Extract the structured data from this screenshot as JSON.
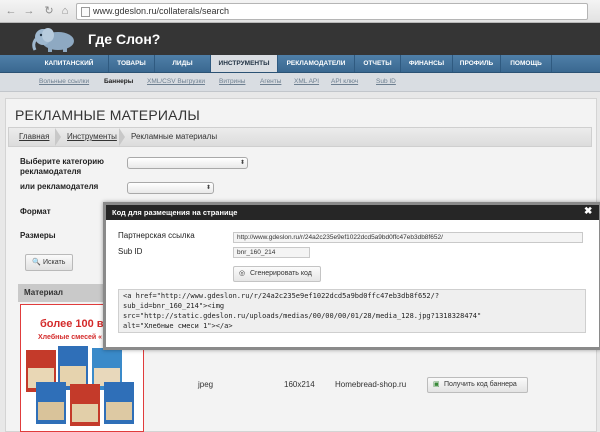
{
  "browser": {
    "url": "www.gdeslon.ru/collaterals/search"
  },
  "site": {
    "logo_text": "Где Слон?"
  },
  "nav": {
    "items": [
      {
        "label": "КАПИТАНСКИЙ МОСТИК"
      },
      {
        "label": "ТОВАРЫ"
      },
      {
        "label": "ЛИДЫ"
      },
      {
        "label": "ИНСТРУМЕНТЫ",
        "active": true
      },
      {
        "label": "РЕКЛАМОДАТЕЛИ"
      },
      {
        "label": "ОТЧЕТЫ"
      },
      {
        "label": "ФИНАНСЫ"
      },
      {
        "label": "ПРОФИЛЬ"
      },
      {
        "label": "ПОМОЩЬ"
      }
    ]
  },
  "subnav": {
    "items": [
      {
        "label": "Вольные ссылки"
      },
      {
        "label": "Баннеры",
        "active": true
      },
      {
        "label": "XML/CSV Выгрузки"
      },
      {
        "label": "Витрины"
      },
      {
        "label": "Агенты"
      },
      {
        "label": "XML API"
      },
      {
        "label": "API ключ"
      },
      {
        "label": "Sub ID"
      }
    ]
  },
  "page": {
    "title": "РЕКЛАМНЫЕ МАТЕРИАЛЫ",
    "breadcrumb": [
      "Главная",
      "Инструменты",
      "Рекламные материалы"
    ]
  },
  "filters": {
    "category_label_line1": "Выберите категорию",
    "category_label_line2": "рекламодателя",
    "advertiser_label": "или рекламодателя",
    "format_label": "Формат",
    "sizes_label": "Размеры",
    "search_button": "Искать"
  },
  "results": {
    "material_header": "Материал",
    "banner_headline": "более 100 в",
    "banner_sub": "Хлебные смесей «",
    "row": {
      "format": "jpeg",
      "size": "160x214",
      "advertiser": "Homebread-shop.ru",
      "button": "Получить код баннера"
    }
  },
  "modal": {
    "title": "Код для размещения на странице",
    "partner_link_label": "Партнерская ссылка",
    "partner_link_value": "http://www.gdeslon.ru/r/24a2c235e9ef1022dcd5a9bd0ffc47eb3db8f652/",
    "subid_label": "Sub ID",
    "subid_value": "bnr_160_214",
    "generate_button": "Сгенерировать код",
    "code_lines": [
      "<a href=\"http://www.gdeslon.ru/r/24a2c235e9ef1022dcd5a9bd0ffc47eb3db8f652/?",
      "sub_id=bnr_160_214\"><img",
      "src=\"http://static.gdeslon.ru/uploads/medias/00/00/00/01/28/media_128.jpg?1318328474\"",
      "alt=\"Хлебные смеси 1\"></a>"
    ]
  },
  "colors": {
    "nav_blue": "#3f6f98",
    "header_dark": "#353535",
    "banner_red": "#d42b2b"
  }
}
